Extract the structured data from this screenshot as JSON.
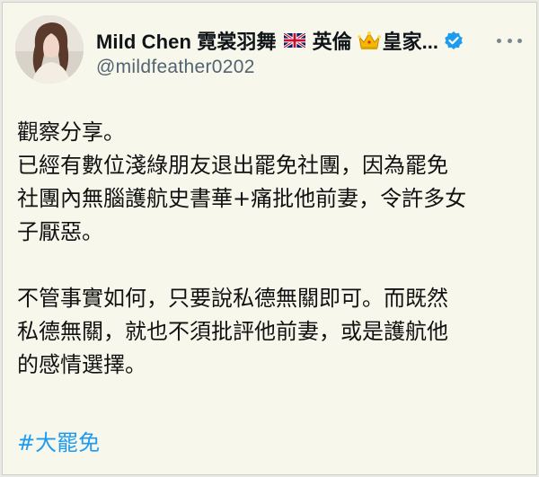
{
  "author": {
    "display_name": "Mild Chen 霓裳羽舞",
    "name_suffix": "英倫",
    "name_suffix_2": "皇家...",
    "handle": "@mildfeather0202",
    "verified": true,
    "badges": [
      "uk-flag-icon",
      "crown-icon",
      "verified-icon"
    ]
  },
  "post": {
    "paragraph_1": [
      "觀察分享。",
      "已經有數位淺綠朋友退出罷免社團，因為罷免",
      "社團內無腦護航史書華+痛批他前妻，令許多女",
      "子厭惡。"
    ],
    "paragraph_2": [
      "不管事實如何，只要說私德無關即可。而既然",
      "私德無關，就也不須批評他前妻，或是護航他",
      "的感情選擇。"
    ],
    "hashtag": "#大罷免"
  },
  "colors": {
    "background": "#f7f7ec",
    "handle": "#536471",
    "link": "#1d9bf0",
    "verified": "#1d9bf0"
  }
}
